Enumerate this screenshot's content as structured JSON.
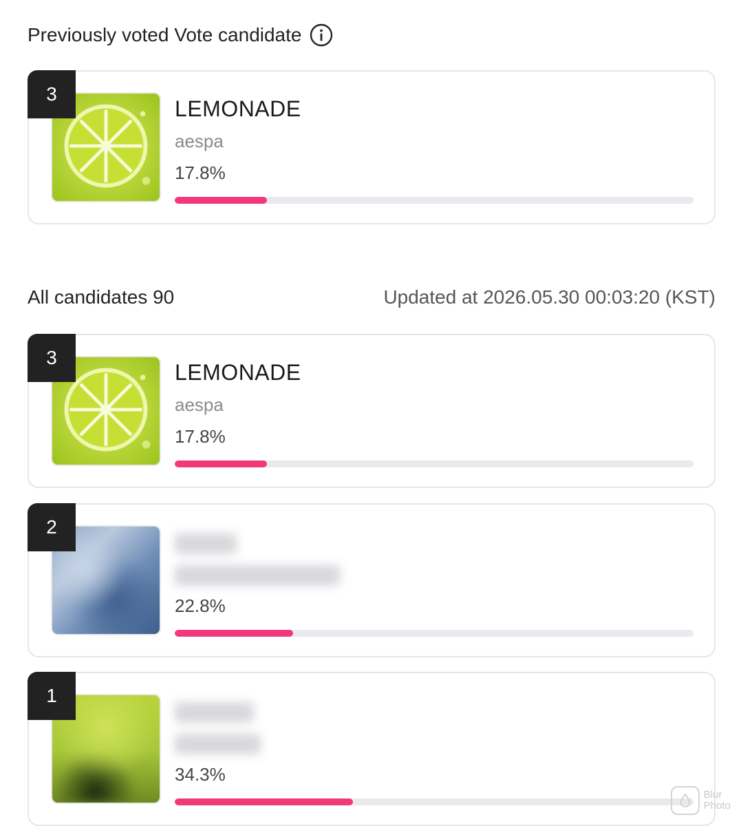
{
  "previously_voted": {
    "title": "Previously voted Vote candidate",
    "info_icon": "info-icon",
    "candidate": {
      "rank": "3",
      "song": "LEMONADE",
      "artist": "aespa",
      "percent_label": "17.8%",
      "percent": 17.8,
      "thumbnail": "lemon-slice"
    }
  },
  "all_candidates": {
    "label": "All candidates 90",
    "updated": "Updated at 2026.05.30 00:03:20 (KST)",
    "items": [
      {
        "rank": "3",
        "song": "LEMONADE",
        "artist": "aespa",
        "percent_label": "17.8%",
        "percent": 17.8,
        "thumbnail": "lemon-slice"
      },
      {
        "rank": "2",
        "song": "",
        "artist": "",
        "percent_label": "22.8%",
        "percent": 22.8,
        "thumbnail": "blurred-blue"
      },
      {
        "rank": "1",
        "song": "",
        "artist": "",
        "percent_label": "34.3%",
        "percent": 34.3,
        "thumbnail": "blurred-green"
      }
    ]
  },
  "watermark": {
    "line1": "Blur",
    "line2": "Photo"
  },
  "colors": {
    "bar_fill": "#f2387b",
    "bar_track": "#e9e9ee",
    "badge": "#222222"
  }
}
